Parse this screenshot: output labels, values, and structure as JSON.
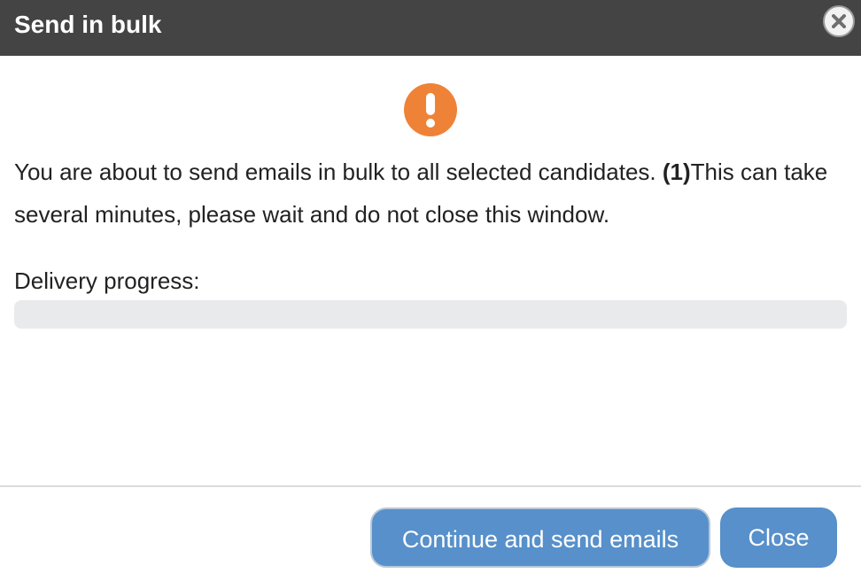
{
  "dialog": {
    "title": "Send in bulk",
    "close_icon": "close-x-icon",
    "alert_icon": "exclamation-circle-icon",
    "alert_color": "#ee8337",
    "message": {
      "part1": "You are about to send emails in bulk to all selected candidates. ",
      "bold": "(1)",
      "part2": "This can take several minutes, please wait and do not close this window."
    },
    "progress": {
      "label": "Delivery progress:",
      "value": 0
    },
    "buttons": {
      "continue_label": "Continue and send emails",
      "close_label": "Close"
    },
    "colors": {
      "titlebar": "#454445",
      "button": "#5790ca"
    }
  }
}
